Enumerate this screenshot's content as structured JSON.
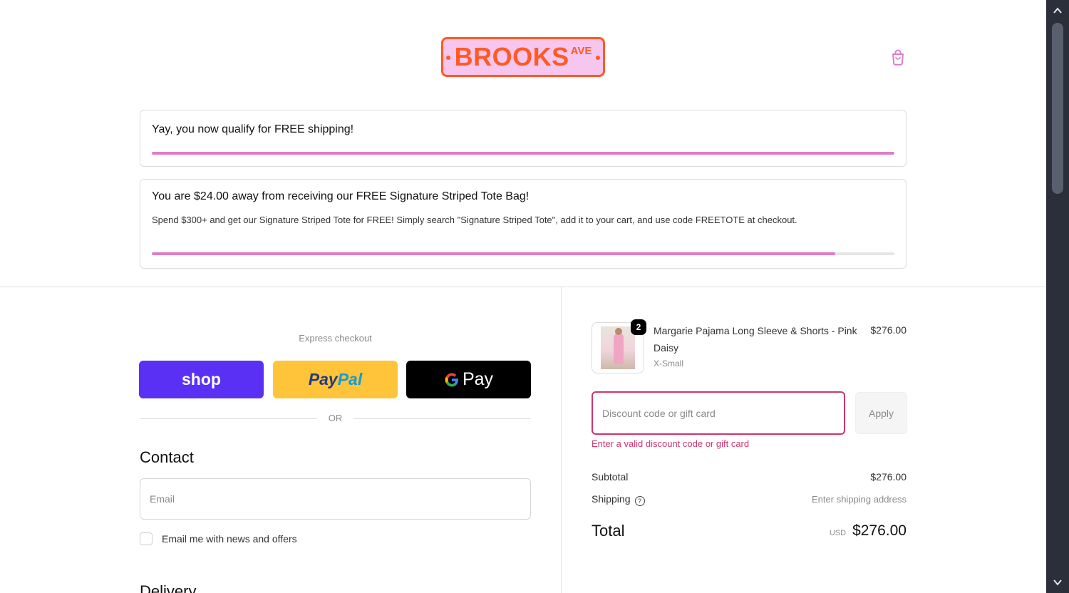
{
  "header": {
    "logo_text": "BROOKS",
    "logo_superscript": "AVE",
    "cart_icon": "shopping-bag-icon"
  },
  "banners": {
    "free_shipping": {
      "title": "Yay, you now qualify for FREE shipping!",
      "progress": 1.0
    },
    "tote": {
      "title": "You are $24.00 away from receiving our FREE Signature Striped Tote Bag!",
      "description": "Spend $300+ and get our Signature Striped Tote for FREE! Simply search \"Signature Striped Tote\", add it to your cart, and use code FREETOTE at checkout.",
      "progress": 0.92
    }
  },
  "express": {
    "label": "Express checkout",
    "shop_label": "shop",
    "paypal_part1": "Pay",
    "paypal_part2": "Pal",
    "gpay_label": "Pay",
    "or_label": "OR"
  },
  "contact": {
    "heading": "Contact",
    "email_placeholder": "Email",
    "email_value": "",
    "newsletter_label": "Email me with news and offers",
    "newsletter_checked": false
  },
  "delivery": {
    "heading": "Delivery"
  },
  "order": {
    "item": {
      "name": "Margarie Pajama Long Sleeve & Shorts - Pink Daisy",
      "variant": "X-Small",
      "price": "$276.00",
      "quantity": "2"
    },
    "discount_placeholder": "Discount code or gift card",
    "apply_label": "Apply",
    "discount_error": "Enter a valid discount code or gift card",
    "subtotal_label": "Subtotal",
    "subtotal_value": "$276.00",
    "shipping_label": "Shipping",
    "shipping_value": "Enter shipping address",
    "total_label": "Total",
    "currency": "USD",
    "total_value": "$276.00"
  },
  "colors": {
    "accent": "#e07cc7",
    "error": "#d0346c",
    "logo_orange": "#ff5a24",
    "logo_pink": "#f6c6ee",
    "shop_purple": "#5a31f4",
    "paypal_yellow": "#ffc439"
  }
}
